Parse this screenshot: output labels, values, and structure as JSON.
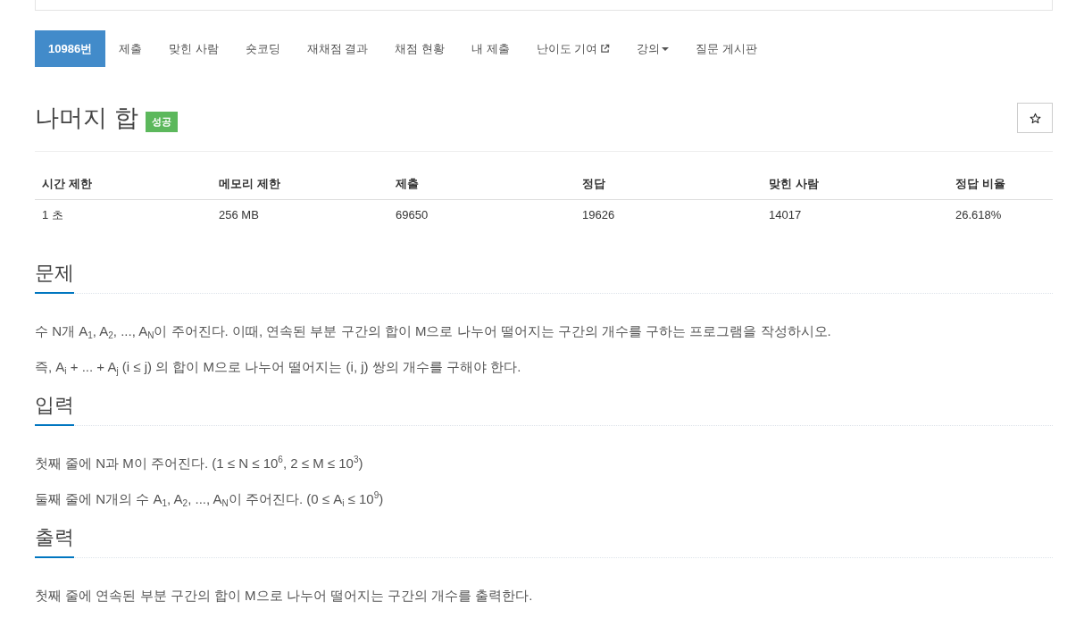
{
  "tabs": [
    {
      "label": "10986번",
      "selected": true,
      "kind": "plain"
    },
    {
      "label": "제출",
      "selected": false,
      "kind": "plain"
    },
    {
      "label": "맞힌 사람",
      "selected": false,
      "kind": "plain"
    },
    {
      "label": "숏코딩",
      "selected": false,
      "kind": "plain"
    },
    {
      "label": "재채점 결과",
      "selected": false,
      "kind": "plain"
    },
    {
      "label": "채점 현황",
      "selected": false,
      "kind": "plain"
    },
    {
      "label": "내 제출",
      "selected": false,
      "kind": "plain"
    },
    {
      "label": "난이도 기여",
      "selected": false,
      "kind": "external"
    },
    {
      "label": "강의",
      "selected": false,
      "kind": "dropdown"
    },
    {
      "label": "질문 게시판",
      "selected": false,
      "kind": "plain"
    }
  ],
  "problem": {
    "title": "나머지 합",
    "badge": {
      "label": "성공",
      "kind": "success"
    }
  },
  "stats": {
    "columns": [
      "시간 제한",
      "메모리 제한",
      "제출",
      "정답",
      "맞힌 사람",
      "정답 비율"
    ],
    "rows": [
      [
        "1 초",
        "256 MB",
        "69650",
        "19626",
        "14017",
        "26.618%"
      ]
    ]
  },
  "sections": [
    {
      "heading": "문제",
      "paragraphs": [
        "수 N개 A$_{1}$, A$_{2}$, ..., A$_{N}$이 주어진다. 이때, 연속된 부분 구간의 합이 M으로 나누어 떨어지는 구간의 개수를 구하는 프로그램을 작성하시오.",
        "즉, A$_{i}$ + ... + A$_{j}$ (i ≤ j) 의 합이 M으로 나누어 떨어지는 (i, j) 쌍의 개수를 구해야 한다."
      ]
    },
    {
      "heading": "입력",
      "paragraphs": [
        "첫째 줄에 N과 M이 주어진다. (1 ≤ N ≤ 10$^{6}$, 2 ≤ M ≤ 10$^{3}$)",
        "둘째 줄에 N개의 수 A$_{1}$, A$_{2}$, ..., A$_{N}$이 주어진다. (0 ≤ A$_{i}$ ≤ 10$^{9}$)"
      ]
    },
    {
      "heading": "출력",
      "paragraphs": [
        "첫째 줄에 연속된 부분 구간의 합이 M으로 나누어 떨어지는 구간의 개수를 출력한다."
      ]
    }
  ]
}
